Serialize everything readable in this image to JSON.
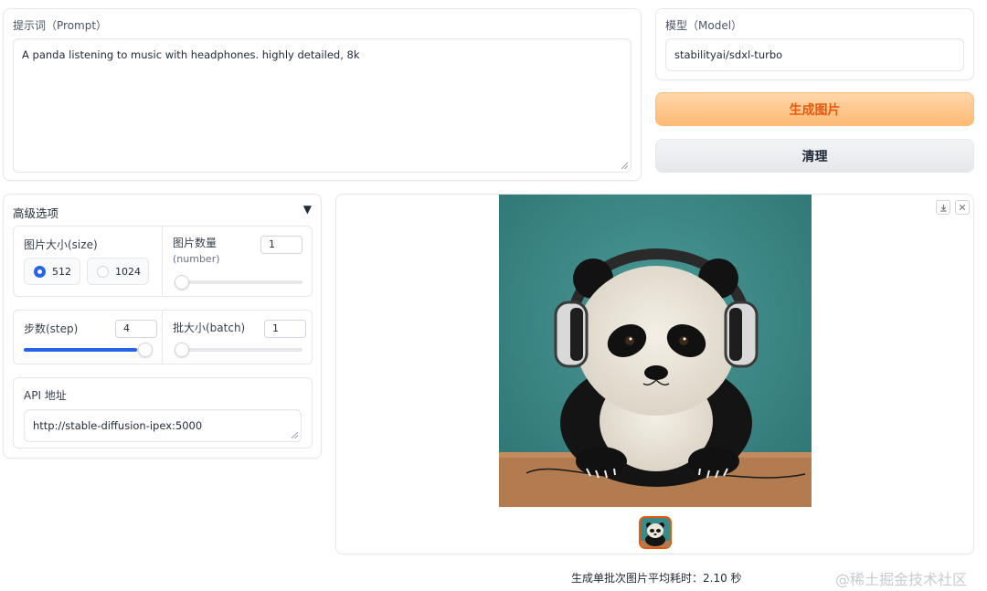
{
  "prompt": {
    "label": "提示词（Prompt）",
    "value": "A panda listening to music with headphones. highly detailed, 8k"
  },
  "model": {
    "label": "模型（Model）",
    "value": "stabilityai/sdxl-turbo"
  },
  "buttons": {
    "generate": "生成图片",
    "clear": "清理"
  },
  "advanced": {
    "title": "高级选项",
    "toggle_glyph": "▼",
    "size": {
      "label": "图片大小(size)",
      "options": [
        "512",
        "1024"
      ],
      "selected": "512"
    },
    "number": {
      "label_line1": "图片数量",
      "label_line2": "(number)",
      "value": "1",
      "slider_fraction": 0
    },
    "step": {
      "label": "步数(step)",
      "value": "4",
      "slider_fraction": 1
    },
    "batch": {
      "label": "批大小(batch)",
      "value": "1",
      "slider_fraction": 0
    },
    "api": {
      "label": "API 地址",
      "value": "http://stable-diffusion-ipex:5000"
    }
  },
  "gallery": {
    "download_icon": "download-icon",
    "close_icon": "close-icon",
    "colors": {
      "background": "#3a8a8a",
      "table": "#b07a4e",
      "thumbnail_border": "#ea580c"
    }
  },
  "status": {
    "text": "生成单批次图片平均耗时：2.10 秒"
  },
  "watermark": "@稀土掘金技术社区"
}
